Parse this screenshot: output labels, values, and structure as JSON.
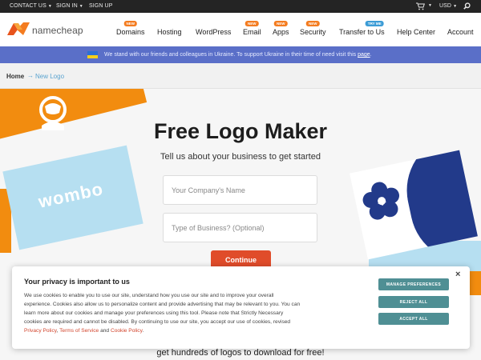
{
  "topbar": {
    "contact": "CONTACT US",
    "signin": "SIGN IN",
    "signup": "SIGN UP",
    "currency": "USD"
  },
  "nav": {
    "brand": "namecheap",
    "items": [
      {
        "label": "Domains",
        "badge": "NEW"
      },
      {
        "label": "Hosting",
        "badge": ""
      },
      {
        "label": "WordPress",
        "badge": ""
      },
      {
        "label": "Email",
        "badge": "NEW"
      },
      {
        "label": "Apps",
        "badge": "NEW"
      },
      {
        "label": "Security",
        "badge": "NEW"
      },
      {
        "label": "Transfer to Us",
        "badge": "TRY ME"
      },
      {
        "label": "Help Center",
        "badge": ""
      },
      {
        "label": "Account",
        "badge": ""
      }
    ]
  },
  "banner": {
    "text": "We stand with our friends and colleagues in Ukraine. To support Ukraine in their time of need visit this",
    "link": "page",
    "end": "."
  },
  "breadcrumb": {
    "home": "Home",
    "arrow": "→",
    "current": "New Logo"
  },
  "hero": {
    "card_text": "wombo",
    "title": "Free Logo Maker",
    "subtitle": "Tell us about your business to get started",
    "company_placeholder": "Your Company's Name",
    "type_placeholder": "Type of Business? (Optional)",
    "continue": "Continue",
    "bottom_text": "get hundreds of logos to download for free!"
  },
  "privacy": {
    "title": "Your privacy is important to us",
    "body": "We use cookies to enable you to use our site, understand how you use our site and to improve your overall experience. Cookies also allow us to personalize content and provide advertising that may be relevant to you. You can learn more about our cookies and manage your preferences using this tool. Please note that Strictly Necessary cookies are required and cannot be disabled. By continuing to use our site, you accept our use of cookies, revised",
    "privacy_link": "Privacy Policy",
    "sep1": ",",
    "terms_link": "Terms of Service",
    "and": "and",
    "cookie_link": "Cookie Policy",
    "end": ".",
    "manage": "MANAGE PREFERENCES",
    "reject": "REJECT ALL",
    "accept": "ACCEPT ALL",
    "close": "×"
  },
  "colors": {
    "brand_orange": "#f28c0f",
    "continue_red": "#e04c2a",
    "banner_blue": "#5a6fc8",
    "privacy_button": "#4f8f94"
  }
}
